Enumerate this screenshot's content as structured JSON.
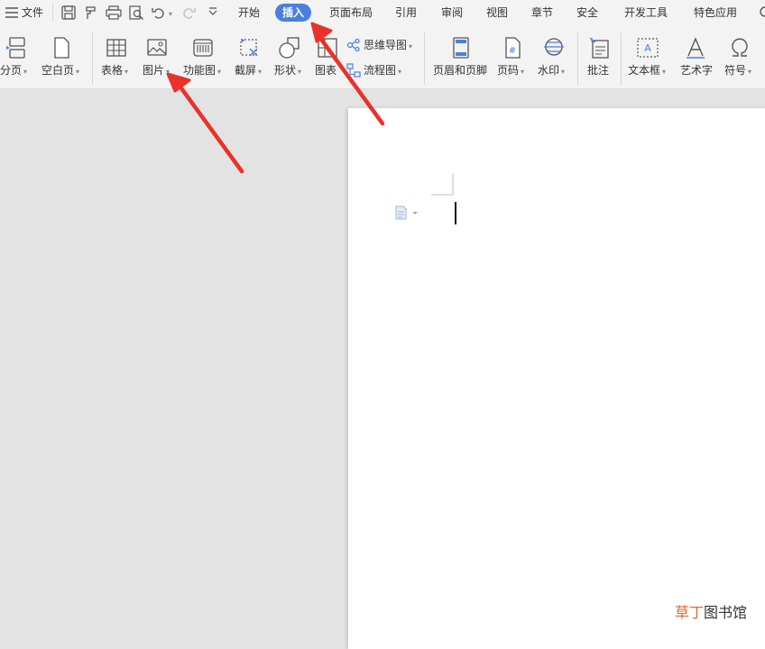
{
  "menubar": {
    "file_label": "文件",
    "tabs": [
      "开始",
      "插入",
      "页面布局",
      "引用",
      "审阅",
      "视图",
      "章节",
      "安全",
      "开发工具",
      "特色应用"
    ],
    "active_tab": "插入"
  },
  "ribbon": {
    "page_break_label": "分页",
    "blank_page_label": "空白页",
    "table_label": "表格",
    "picture_label": "图片",
    "function_chart_label": "功能图",
    "screenshot_label": "截屏",
    "shape_label": "形状",
    "chart_label": "图表",
    "mind_map_label": "思维导图",
    "flowchart_label": "流程图",
    "header_footer_label": "页眉和页脚",
    "page_number_label": "页码",
    "watermark_label": "水印",
    "comment_label": "批注",
    "textbox_label": "文本框",
    "wordart_label": "艺术字",
    "symbol_label": "符号"
  },
  "watermark": {
    "part1": "草丁",
    "part2": "图书馆"
  },
  "colors": {
    "accent": "#4a7fe0",
    "arrow": "#e8322a",
    "brand_orange": "#e06a2a",
    "paper": "#ffffff",
    "workspace": "#e3e3e3"
  }
}
